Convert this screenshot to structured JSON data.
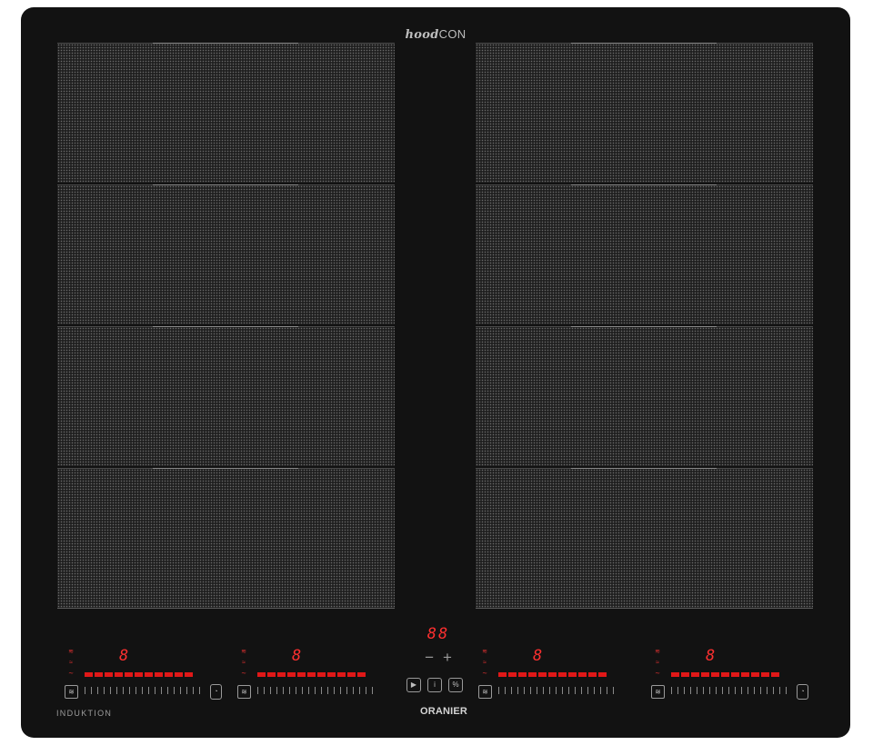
{
  "brand_top": {
    "part1": "hood",
    "part2": "CON"
  },
  "brand_bottom": "ORANIER",
  "label_left": "INDUKTION",
  "colors": {
    "surface": "#121212",
    "display": "#ff3030",
    "bar": "#e01818"
  },
  "panels": {
    "left": {
      "zones": 4
    },
    "right": {
      "zones": 4
    }
  },
  "center": {
    "display": "88",
    "minus": "−",
    "plus": "+",
    "buttons": [
      {
        "icon": "play-pause-icon",
        "glyph": "▶"
      },
      {
        "icon": "info-icon",
        "glyph": "i"
      },
      {
        "icon": "percent-icon",
        "glyph": "%"
      }
    ]
  },
  "controls": [
    {
      "name": "left-front",
      "digit": "8",
      "bars": 11,
      "boost": "≋",
      "timer": "◔"
    },
    {
      "name": "left-rear",
      "digit": "8",
      "bars": 11,
      "boost": "≋"
    },
    {
      "name": "right-front",
      "digit": "8",
      "bars": 11,
      "boost": "≋"
    },
    {
      "name": "right-rear",
      "digit": "8",
      "bars": 11,
      "boost": "≋",
      "timer": "◔"
    }
  ],
  "heat_icons": [
    "≋",
    "≈",
    "∼"
  ]
}
